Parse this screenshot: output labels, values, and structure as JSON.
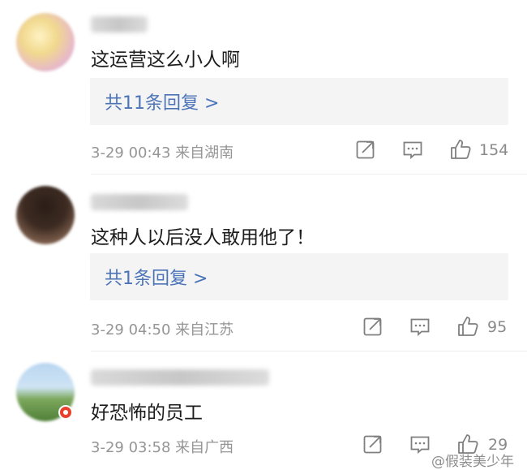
{
  "comments": [
    {
      "text": "这运营这么小人啊",
      "reply_label": "共11条回复 >",
      "meta": "3-29 00:43 来自湖南",
      "likes": "154"
    },
    {
      "text": "这种人以后没人敢用他了！",
      "reply_label": "共1条回复 >",
      "meta": "3-29 04:50 来自江苏",
      "likes": "95"
    },
    {
      "text": "好恐怖的员工",
      "meta": "3-29 03:58 来自广西",
      "likes": "29"
    }
  ],
  "watermark": "@假装美少年",
  "colors": {
    "link": "#4b74b8",
    "meta": "#959595",
    "reply_bg": "#f4f4f5"
  }
}
